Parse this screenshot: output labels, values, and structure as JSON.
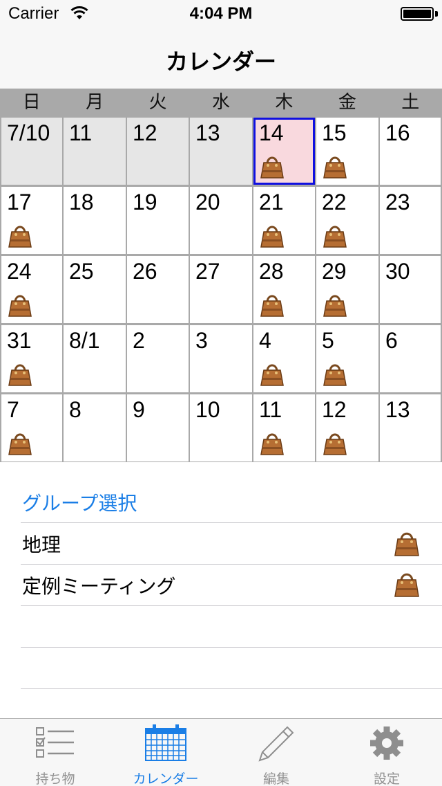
{
  "status": {
    "carrier": "Carrier",
    "time": "4:04 PM"
  },
  "nav": {
    "title": "カレンダー"
  },
  "weekdays": [
    "日",
    "月",
    "火",
    "水",
    "木",
    "金",
    "土"
  ],
  "calendar": {
    "weeks": [
      [
        {
          "label": "7/10",
          "state": "past",
          "bag": false
        },
        {
          "label": "11",
          "state": "past",
          "bag": false
        },
        {
          "label": "12",
          "state": "past",
          "bag": false
        },
        {
          "label": "13",
          "state": "past",
          "bag": false
        },
        {
          "label": "14",
          "state": "today",
          "bag": true
        },
        {
          "label": "15",
          "state": "",
          "bag": true
        },
        {
          "label": "16",
          "state": "",
          "bag": false
        }
      ],
      [
        {
          "label": "17",
          "state": "",
          "bag": true
        },
        {
          "label": "18",
          "state": "",
          "bag": false
        },
        {
          "label": "19",
          "state": "",
          "bag": false
        },
        {
          "label": "20",
          "state": "",
          "bag": false
        },
        {
          "label": "21",
          "state": "",
          "bag": true
        },
        {
          "label": "22",
          "state": "",
          "bag": true
        },
        {
          "label": "23",
          "state": "",
          "bag": false
        }
      ],
      [
        {
          "label": "24",
          "state": "",
          "bag": true
        },
        {
          "label": "25",
          "state": "",
          "bag": false
        },
        {
          "label": "26",
          "state": "",
          "bag": false
        },
        {
          "label": "27",
          "state": "",
          "bag": false
        },
        {
          "label": "28",
          "state": "",
          "bag": true
        },
        {
          "label": "29",
          "state": "",
          "bag": true
        },
        {
          "label": "30",
          "state": "",
          "bag": false
        }
      ],
      [
        {
          "label": "31",
          "state": "",
          "bag": true
        },
        {
          "label": "8/1",
          "state": "",
          "bag": false
        },
        {
          "label": "2",
          "state": "",
          "bag": false
        },
        {
          "label": "3",
          "state": "",
          "bag": false
        },
        {
          "label": "4",
          "state": "",
          "bag": true
        },
        {
          "label": "5",
          "state": "",
          "bag": true
        },
        {
          "label": "6",
          "state": "",
          "bag": false
        }
      ],
      [
        {
          "label": "7",
          "state": "",
          "bag": true
        },
        {
          "label": "8",
          "state": "",
          "bag": false
        },
        {
          "label": "9",
          "state": "",
          "bag": false
        },
        {
          "label": "10",
          "state": "",
          "bag": false
        },
        {
          "label": "11",
          "state": "",
          "bag": true
        },
        {
          "label": "12",
          "state": "",
          "bag": true
        },
        {
          "label": "13",
          "state": "",
          "bag": false
        }
      ]
    ]
  },
  "groups": {
    "title": "グループ選択",
    "items": [
      {
        "label": "地理",
        "icon": "handbag-icon"
      },
      {
        "label": "定例ミーティング",
        "icon": "handbag-icon"
      }
    ]
  },
  "tabs": [
    {
      "label": "持ち物",
      "icon": "checklist-icon",
      "active": false
    },
    {
      "label": "カレンダー",
      "icon": "calendar-icon",
      "active": true
    },
    {
      "label": "編集",
      "icon": "pencil-icon",
      "active": false
    },
    {
      "label": "設定",
      "icon": "gear-icon",
      "active": false
    }
  ],
  "colors": {
    "accent": "#1a7ee6",
    "today_fill": "#f9d9de",
    "today_border": "#1010e0",
    "past_fill": "#e6e6e6",
    "grid_line": "#a9a9a9"
  }
}
